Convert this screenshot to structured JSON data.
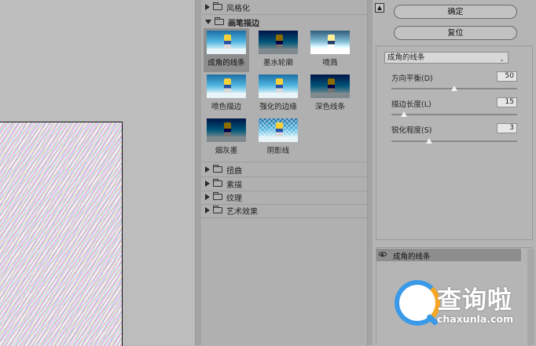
{
  "gallery": {
    "categories": [
      {
        "label": "风格化",
        "expanded": false
      },
      {
        "label": "画笔描边",
        "expanded": true
      },
      {
        "label": "扭曲",
        "expanded": false
      },
      {
        "label": "素描",
        "expanded": false
      },
      {
        "label": "纹理",
        "expanded": false
      },
      {
        "label": "艺术效果",
        "expanded": false
      }
    ],
    "brush_filters": [
      {
        "label": "成角的线条",
        "selected": true
      },
      {
        "label": "墨水轮廓",
        "selected": false
      },
      {
        "label": "喷溅",
        "selected": false
      },
      {
        "label": "喷色描边",
        "selected": false
      },
      {
        "label": "强化的边缘",
        "selected": false
      },
      {
        "label": "深色线条",
        "selected": false
      },
      {
        "label": "烟灰墨",
        "selected": false
      },
      {
        "label": "阴影线",
        "selected": false
      }
    ]
  },
  "panel": {
    "collapse_icon": "collapse-up-icon",
    "ok_label": "确定",
    "reset_label": "复位",
    "filter_select": "成角的线条",
    "params": [
      {
        "label": "方向平衡(D)",
        "value": "50",
        "slider_fraction": 0.5
      },
      {
        "label": "描边长度(L)",
        "value": "15",
        "slider_fraction": 0.1
      },
      {
        "label": "锐化程度(S)",
        "value": "3",
        "slider_fraction": 0.3
      }
    ],
    "layer_label": "成角的线条"
  },
  "watermark": {
    "title": "查询啦",
    "url": "chaxunla.com",
    "colors": {
      "blue": "#3a9ae8",
      "orange": "#f5a623"
    }
  }
}
